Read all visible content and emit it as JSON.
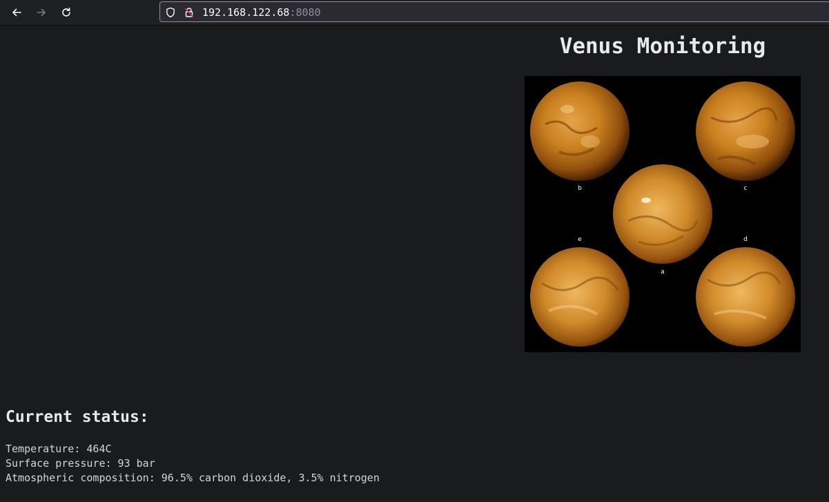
{
  "browser": {
    "url_host": "192.168.122.68",
    "url_port": ":8080",
    "back_icon": "arrow-left-icon",
    "forward_icon": "arrow-right-icon",
    "reload_icon": "reload-icon",
    "tracking_icon": "shield-icon",
    "security_icon": "insecure-lock-icon"
  },
  "page": {
    "title": "Venus Monitoring",
    "image": {
      "labels": {
        "a": "a",
        "b": "b",
        "c": "c",
        "d": "d",
        "e": "e"
      }
    },
    "status_heading": "Current status:",
    "status": {
      "temperature": "Temperature: 464C",
      "pressure": "Surface pressure: 93 bar",
      "composition": "Atmospheric composition: 96.5% carbon dioxide, 3.5% nitrogen"
    }
  },
  "colors": {
    "page_background": "#1a1b1d",
    "toolbar_background": "#1f2023",
    "urlbar_background": "#2b2a33",
    "text": "#e9e9ea",
    "planet_orange": "#c9801f"
  }
}
